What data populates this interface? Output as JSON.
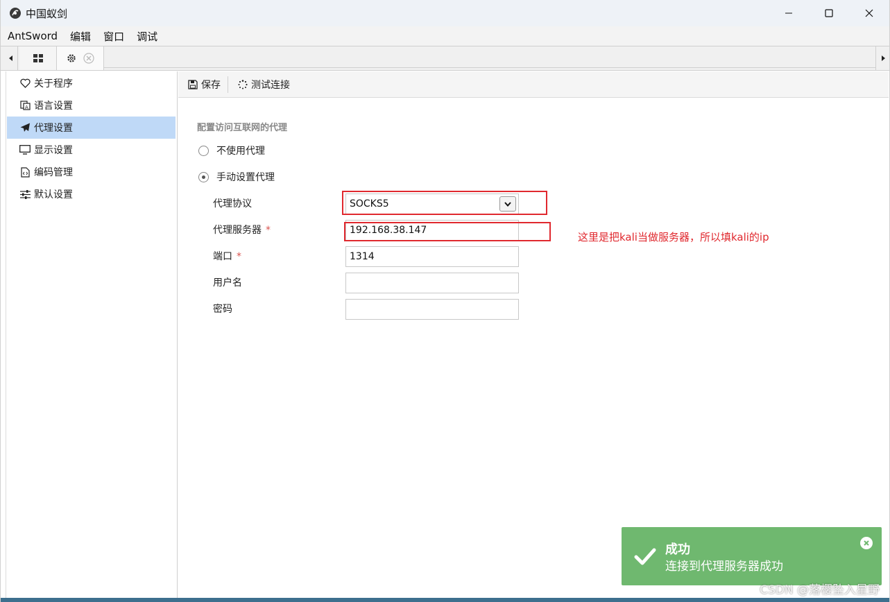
{
  "window": {
    "title": "中国蚁剑"
  },
  "menu": [
    "AntSword",
    "编辑",
    "窗口",
    "调试"
  ],
  "sidebar": {
    "items": [
      {
        "label": "关于程序",
        "icon": "heart-icon"
      },
      {
        "label": "语言设置",
        "icon": "language-icon"
      },
      {
        "label": "代理设置",
        "icon": "paper-plane-icon",
        "active": true
      },
      {
        "label": "显示设置",
        "icon": "monitor-icon"
      },
      {
        "label": "编码管理",
        "icon": "code-file-icon"
      },
      {
        "label": "默认设置",
        "icon": "sliders-icon"
      }
    ]
  },
  "toolbar": {
    "save_label": "保存",
    "test_label": "测试连接"
  },
  "form": {
    "section_title": "配置访问互联网的代理",
    "no_proxy_label": "不使用代理",
    "manual_proxy_label": "手动设置代理",
    "selected_mode": "manual",
    "protocol_label": "代理协议",
    "protocol_value": "SOCKS5",
    "server_label": "代理服务器",
    "server_value": "192.168.38.147",
    "port_label": "端口",
    "port_value": "1314",
    "username_label": "用户名",
    "username_value": "",
    "password_label": "密码",
    "password_value": "",
    "required_mark": "*"
  },
  "annotation": "这里是把kali当做服务器，所以填kali的ip",
  "toast": {
    "title": "成功",
    "message": "连接到代理服务器成功",
    "color": "#6fb86f"
  },
  "watermark": "CSDN @落樱坠入星野",
  "colors": {
    "active_item": "#bfd9f7",
    "annotation_red": "#e0282e"
  }
}
